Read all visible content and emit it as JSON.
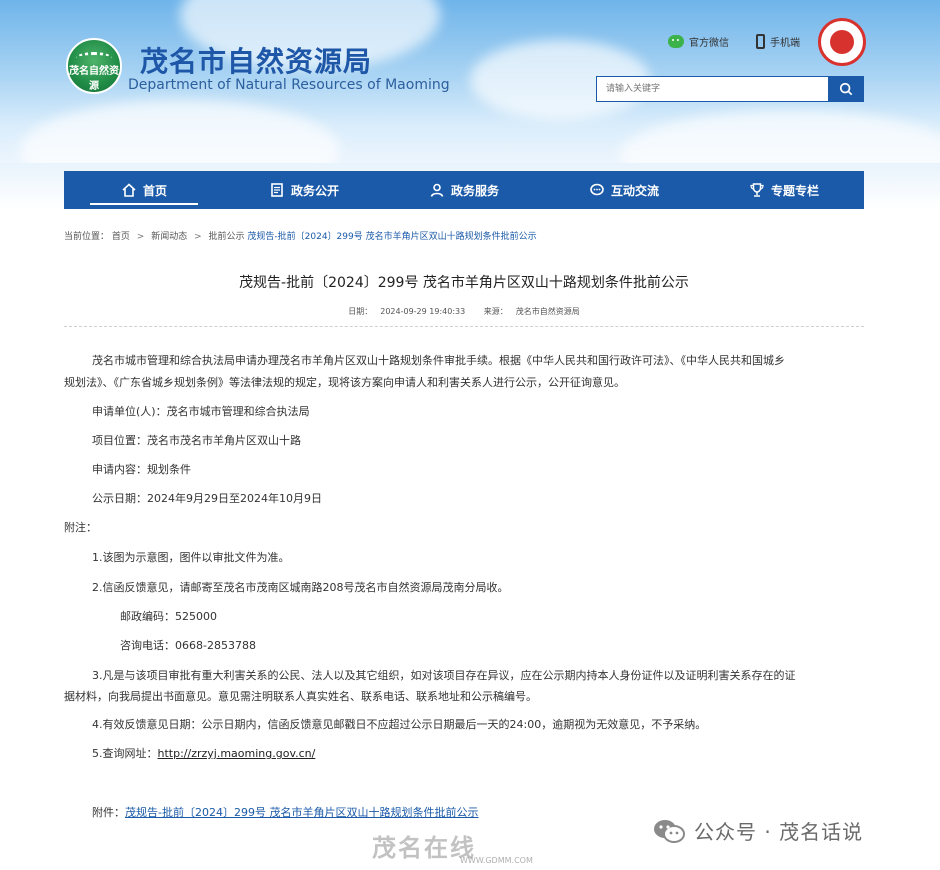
{
  "header": {
    "logo_text": "茂名自然资源",
    "title": "茂名市自然资源局",
    "subtitle": "Department of Natural Resources of Maoming",
    "wechat_label": "官方微信",
    "mobile_label": "手机端",
    "search_placeholder": "请输入关键字"
  },
  "nav": {
    "items": [
      {
        "label": "首页",
        "icon": "home-icon"
      },
      {
        "label": "政务公开",
        "icon": "document-icon"
      },
      {
        "label": "政务服务",
        "icon": "service-person-icon"
      },
      {
        "label": "互动交流",
        "icon": "chat-icon"
      },
      {
        "label": "专题专栏",
        "icon": "trophy-icon"
      }
    ]
  },
  "breadcrumb": {
    "label": "当前位置：",
    "items": [
      "首页",
      "新闻动态",
      "批前公示"
    ],
    "current": "茂规告-批前〔2024〕299号 茂名市羊角片区双山十路规划条件批前公示"
  },
  "article": {
    "title": "茂规告-批前〔2024〕299号 茂名市羊角片区双山十路规划条件批前公示",
    "date_label": "日期：",
    "date": "2024-09-29 19:40:33",
    "source_label": "来源：",
    "source": "茂名市自然资源局",
    "intro_line1": "茂名市城市管理和综合执法局申请办理茂名市羊角片区双山十路规划条件审批手续。根据《中华人民共和国行政许可法》、《中华人民共和国城乡",
    "intro_line2": "规划法》、《广东省城乡规划条例》等法律法规的规定，现将该方案向申请人和利害关系人进行公示，公开征询意见。",
    "applicant": "申请单位(人)：茂名市城市管理和综合执法局",
    "location": "项目位置：茂名市茂名市羊角片区双山十路",
    "content": "申请内容：规划条件",
    "period": "公示日期：2024年9月29日至2024年10月9日",
    "notes_label": "附注：",
    "note1": "1.该图为示意图，图件以审批文件为准。",
    "note2": "2.信函反馈意见，请邮寄至茂名市茂南区城南路208号茂名市自然资源局茂南分局收。",
    "postcode": "邮政编码：525000",
    "phone": "咨询电话：0668-2853788",
    "note3_line1": "3.凡是与该项目审批有重大利害关系的公民、法人以及其它组织，如对该项目存在异议，应在公示期内持本人身份证件以及证明利害关系存在的证",
    "note3_line2": "据材料，向我局提出书面意见。意见需注明联系人真实姓名、联系电话、联系地址和公示稿编号。",
    "note4": "4.有效反馈意见日期：公示日期内，信函反馈意见邮戳日不应超过公示日期最后一天的24:00，逾期视为无效意见，不予采纳。",
    "note5_label": "5.查询网址：",
    "note5_url": "http://zrzyj.maoming.gov.cn/",
    "attachment_label": "附件：",
    "attachment_link": "茂规告-批前〔2024〕299号 茂名市羊角片区双山十路规划条件批前公示"
  },
  "watermark": {
    "weixin": "公众号 · 茂名话说",
    "gd_logo": "茂名在线",
    "gd_url": "WWW.GDMM.COM"
  },
  "colors": {
    "nav_blue": "#1b5aa8",
    "title_blue": "#1e56a8",
    "link_blue": "#1b5aa8",
    "logo_green": "#1f8c46",
    "seal_red": "#d8322f"
  }
}
